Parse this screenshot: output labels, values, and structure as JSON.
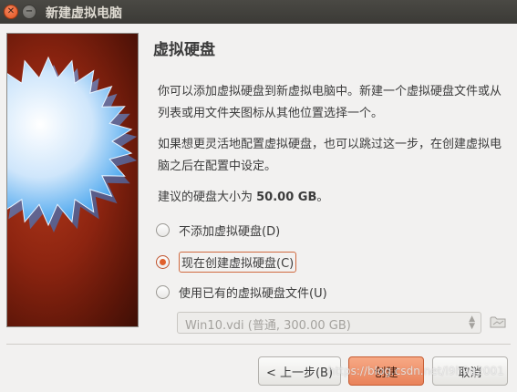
{
  "window": {
    "title": "新建虚拟电脑"
  },
  "page": {
    "heading": "虚拟硬盘",
    "paragraph1": "你可以添加虚拟硬盘到新虚拟电脑中。新建一个虚拟硬盘文件或从列表或用文件夹图标从其他位置选择一个。",
    "paragraph2": "如果想更灵活地配置虚拟硬盘，也可以跳过这一步，在创建虚拟电脑之后在配置中设定。",
    "recommend_prefix": "建议的硬盘大小为 ",
    "recommend_size": "50.00 GB",
    "recommend_suffix": "。"
  },
  "options": [
    {
      "label": "不添加虚拟硬盘(D)",
      "checked": false
    },
    {
      "label": "现在创建虚拟硬盘(C)",
      "checked": true
    },
    {
      "label": "使用已有的虚拟硬盘文件(U)",
      "checked": false
    }
  ],
  "disk_select": {
    "value": "Win10.vdi (普通, 300.00 GB)",
    "enabled": false
  },
  "buttons": {
    "back": "< 上一步(B)",
    "create": "创建",
    "cancel": "取消"
  },
  "watermark": "https://blog.csdn.net/l9h9q2001",
  "colors": {
    "accent": "#e0602c",
    "titlebar": "#3b3a36",
    "panel_bg": "#8c2410"
  },
  "icons": {
    "close": "close-icon",
    "minimize": "minimize-icon",
    "folder": "folder-icon"
  }
}
